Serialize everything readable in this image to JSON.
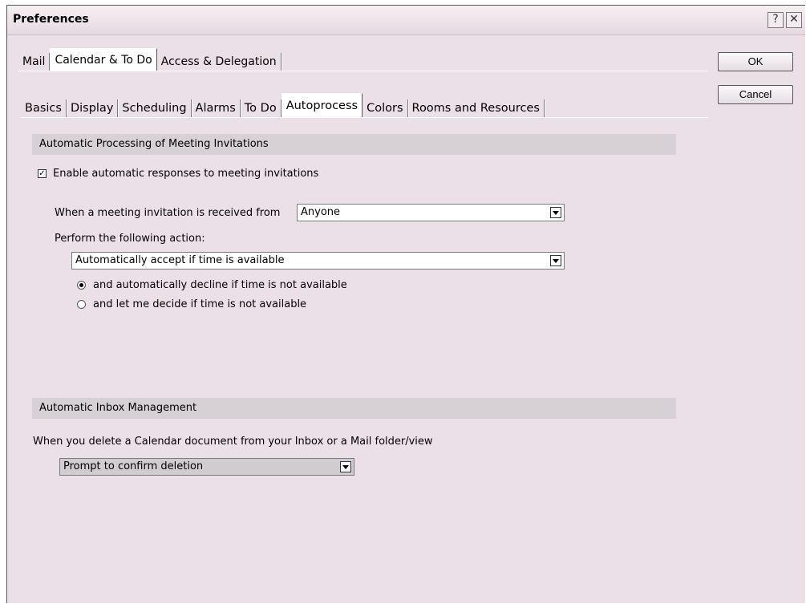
{
  "window": {
    "title": "Preferences",
    "help_icon": "?",
    "close_icon": "✕"
  },
  "main_tabs": [
    "Mail",
    "Calendar & To Do",
    "Access & Delegation"
  ],
  "sub_tabs": [
    "Basics",
    "Display",
    "Scheduling",
    "Alarms",
    "To Do",
    "Autoprocess",
    "Colors",
    "Rooms and Resources"
  ],
  "buttons": {
    "ok": "OK",
    "cancel": "Cancel"
  },
  "section1": {
    "header": "Automatic Processing of Meeting Invitations",
    "enable_label": "Enable automatic responses to meeting invitations",
    "enable_checked": true,
    "received_from_label": "When a meeting invitation is received from",
    "received_from_value": "Anyone",
    "action_label": "Perform the following action:",
    "action_value": "Automatically accept if time is available",
    "radio_decline": "and automatically decline if time is not available",
    "radio_decide": "and let me decide if time is not available",
    "selected_radio": "decline"
  },
  "section2": {
    "header": "Automatic Inbox Management",
    "delete_label": "When you delete a Calendar document from your Inbox or a Mail folder/view",
    "delete_value": "Prompt to confirm deletion"
  }
}
